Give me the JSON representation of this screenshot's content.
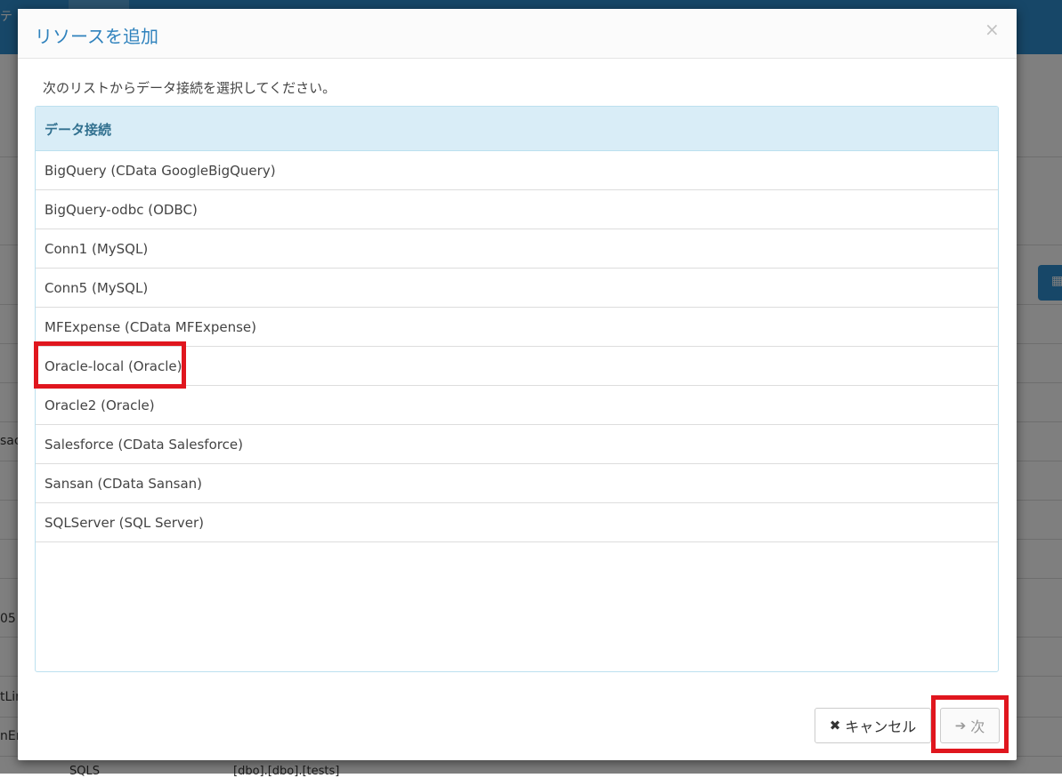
{
  "background": {
    "nav_fragment": "テ",
    "left_fragments": [
      "sac",
      "05",
      "tLin",
      "nEr"
    ],
    "bottom_fragments": [
      "SQLS",
      "[dbo].[dbo].[tests]"
    ],
    "right_button_icon": "table-icon"
  },
  "modal": {
    "title": "リソースを追加",
    "close_label": "×",
    "instruction": "次のリストからデータ接続を選択してください。",
    "list_header": "データ接続",
    "items": [
      "BigQuery (CData GoogleBigQuery)",
      "BigQuery-odbc (ODBC)",
      "Conn1 (MySQL)",
      "Conn5 (MySQL)",
      "MFExpense (CData MFExpense)",
      "Oracle-local (Oracle)",
      "Oracle2 (Oracle)",
      "Salesforce (CData Salesforce)",
      "Sansan (CData Sansan)",
      "SQLServer (SQL Server)"
    ],
    "cancel_label": "キャンセル",
    "cancel_icon": "✖",
    "next_label": "次",
    "next_icon": "➔"
  },
  "colors": {
    "accent": "#2f82bd",
    "highlight": "#e0161e",
    "list_header_bg": "#d9edf7"
  }
}
